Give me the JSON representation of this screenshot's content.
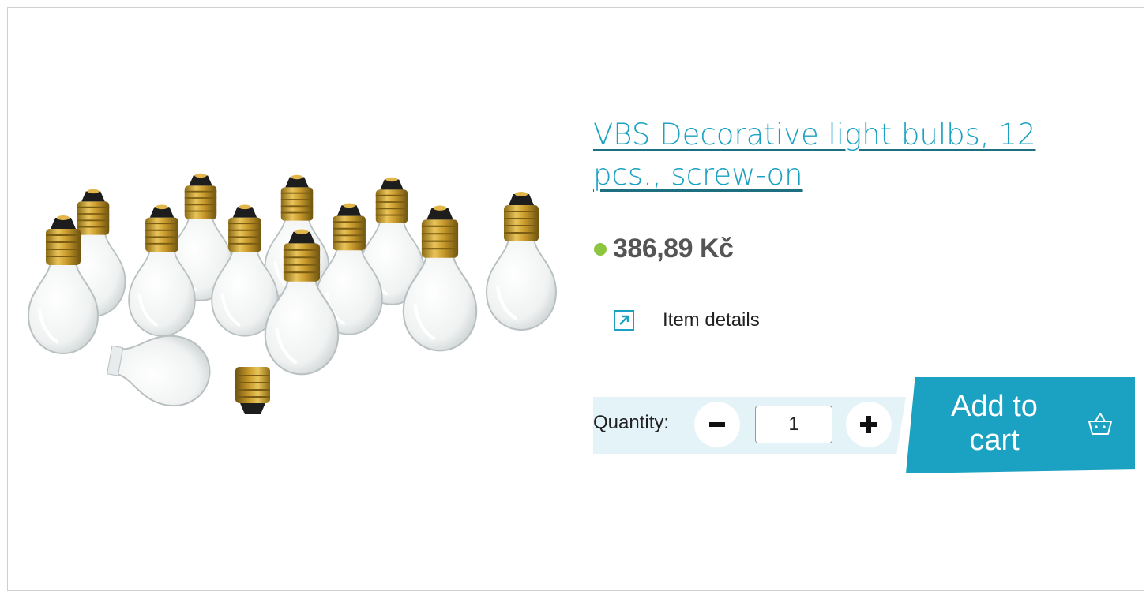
{
  "product": {
    "title": "VBS Decorative light bulbs, 12 pcs., screw-on",
    "price": "386,89 Kč",
    "availability_color": "#8cc63e",
    "image_icon": "light-bulbs-product-photo"
  },
  "details_link": {
    "label": "Item details",
    "icon": "external-link-icon"
  },
  "quantity": {
    "label": "Quantity:",
    "value": "1",
    "decrement_icon": "minus-icon",
    "increment_icon": "plus-icon"
  },
  "cart": {
    "label": "Add to cart",
    "icon": "basket-icon"
  },
  "colors": {
    "accent": "#1ba2c2",
    "quantity_bg": "#e4f3f8"
  }
}
